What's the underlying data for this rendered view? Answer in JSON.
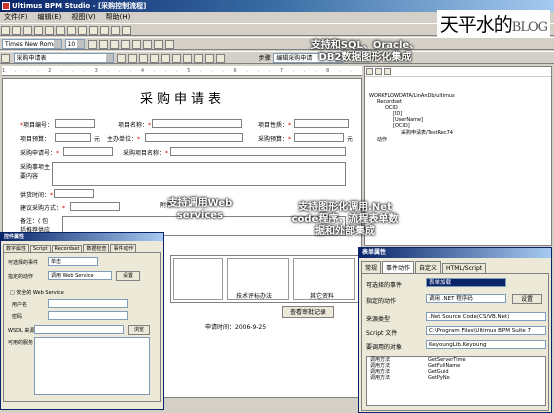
{
  "window": {
    "title": "Ultimus BPM Studio - [采购控制流程]"
  },
  "menu": [
    "文件(F)",
    "编辑(E)",
    "视图(V)",
    "帮助(H)"
  ],
  "toolbar": {
    "font_name": "Times New Roman",
    "font_size": "10",
    "form_combo": "采购申请表",
    "mode_label": "步骤",
    "mode_value": "编辑采购申请"
  },
  "brand": {
    "text": "天平水的",
    "suffix": "BLOG"
  },
  "form": {
    "ruler": "1 . . . 2 . . . 3 . . . 4 . . . 5 . . . 6 . . . 7 . . . 8 . . . 9 . . . 10",
    "title": "采购申请表",
    "labels": {
      "item_no": "项目编号：",
      "item_name": "项目名称：",
      "item_nature": "项目性质：",
      "budget": "项目预算：",
      "unit1": "元",
      "dept": "主办单位：",
      "purchase_budget": "采购预算：",
      "unit2": "元",
      "req_no": "采购申请号：",
      "req_name": "采购项目名称：",
      "content": "采购事项主要内容",
      "supply_time": "供货时间：",
      "method": "建议采购方式：",
      "attach": "附件",
      "note": "备注：( 包括推荐供应商 )"
    },
    "cells": [
      "技术评标办法",
      "其它资料"
    ],
    "time_label": "申请时间：",
    "time_value": "2006-9-25",
    "view_button": "查看审批记录"
  },
  "annotations": {
    "db": "支持和SQL、Oracle、DB2数据图形化集成",
    "ws": "支持调用Web services",
    "net": "支持图形化调用.Net code程序，流程表单数据和外部集成"
  },
  "tree": {
    "root": "WORKFLOWDATA/LinAnDb/ultimus",
    "n1": "Recordset",
    "n2": "OCID",
    "n3": "[ID]",
    "n4": "[UserName]",
    "n5": "[OCID]",
    "n6": "采购申请表/TestRec74",
    "n7": "动作"
  },
  "small_dialog": {
    "title": "控件属性",
    "tabs": [
      "数字属性",
      "Script",
      "Recordset",
      "数据检查",
      "事件动作"
    ],
    "rows": [
      "可选择的事件",
      "选择",
      "指定的动作",
      "调用 Web Service",
      "设置",
      "□ 安全的 Web Service",
      "用户名",
      "密码",
      "WSDL 来源",
      "浏览",
      "可用的服务"
    ],
    "event": "单击"
  },
  "big_dialog": {
    "title": "表单属性",
    "tabs": [
      "常规",
      "事件动作",
      "自定义",
      "HTML/Script"
    ],
    "event_label": "可选择的事件",
    "event_value": "表单加载",
    "action_label": "指定的动作",
    "action_value": "调用 .NET 程序码",
    "setup": "设置",
    "src_label": "来源类型",
    "src_value": ".Net Source Code(CS/VB.Net)",
    "script_label": "Script 文件",
    "script_value": "C:\\Program Files\\Ultimus BPM Suite 7",
    "obj_label": "要调用的对象",
    "obj_value": "KeyoungLib.Keyoung",
    "methods": [
      [
        "调用方法",
        "GetServerTime"
      ],
      [
        "调用方法",
        "GetFullName"
      ],
      [
        "调用方法",
        "GetGuid"
      ],
      [
        "调用方法",
        "GetPyNo"
      ]
    ]
  }
}
